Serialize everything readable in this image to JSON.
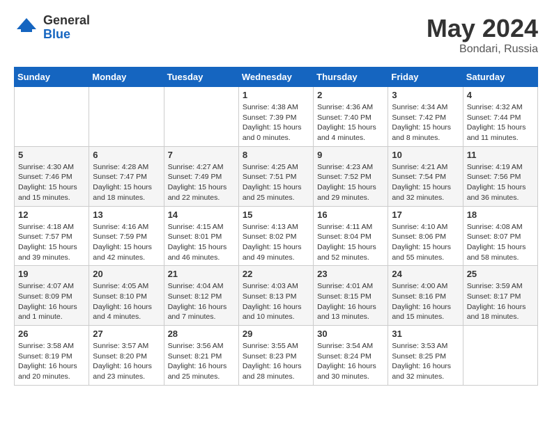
{
  "header": {
    "logo_general": "General",
    "logo_blue": "Blue",
    "month_title": "May 2024",
    "location": "Bondari, Russia"
  },
  "weekdays": [
    "Sunday",
    "Monday",
    "Tuesday",
    "Wednesday",
    "Thursday",
    "Friday",
    "Saturday"
  ],
  "weeks": [
    [
      {
        "day": "",
        "content": ""
      },
      {
        "day": "",
        "content": ""
      },
      {
        "day": "",
        "content": ""
      },
      {
        "day": "1",
        "content": "Sunrise: 4:38 AM\nSunset: 7:39 PM\nDaylight: 15 hours\nand 0 minutes."
      },
      {
        "day": "2",
        "content": "Sunrise: 4:36 AM\nSunset: 7:40 PM\nDaylight: 15 hours\nand 4 minutes."
      },
      {
        "day": "3",
        "content": "Sunrise: 4:34 AM\nSunset: 7:42 PM\nDaylight: 15 hours\nand 8 minutes."
      },
      {
        "day": "4",
        "content": "Sunrise: 4:32 AM\nSunset: 7:44 PM\nDaylight: 15 hours\nand 11 minutes."
      }
    ],
    [
      {
        "day": "5",
        "content": "Sunrise: 4:30 AM\nSunset: 7:46 PM\nDaylight: 15 hours\nand 15 minutes."
      },
      {
        "day": "6",
        "content": "Sunrise: 4:28 AM\nSunset: 7:47 PM\nDaylight: 15 hours\nand 18 minutes."
      },
      {
        "day": "7",
        "content": "Sunrise: 4:27 AM\nSunset: 7:49 PM\nDaylight: 15 hours\nand 22 minutes."
      },
      {
        "day": "8",
        "content": "Sunrise: 4:25 AM\nSunset: 7:51 PM\nDaylight: 15 hours\nand 25 minutes."
      },
      {
        "day": "9",
        "content": "Sunrise: 4:23 AM\nSunset: 7:52 PM\nDaylight: 15 hours\nand 29 minutes."
      },
      {
        "day": "10",
        "content": "Sunrise: 4:21 AM\nSunset: 7:54 PM\nDaylight: 15 hours\nand 32 minutes."
      },
      {
        "day": "11",
        "content": "Sunrise: 4:19 AM\nSunset: 7:56 PM\nDaylight: 15 hours\nand 36 minutes."
      }
    ],
    [
      {
        "day": "12",
        "content": "Sunrise: 4:18 AM\nSunset: 7:57 PM\nDaylight: 15 hours\nand 39 minutes."
      },
      {
        "day": "13",
        "content": "Sunrise: 4:16 AM\nSunset: 7:59 PM\nDaylight: 15 hours\nand 42 minutes."
      },
      {
        "day": "14",
        "content": "Sunrise: 4:15 AM\nSunset: 8:01 PM\nDaylight: 15 hours\nand 46 minutes."
      },
      {
        "day": "15",
        "content": "Sunrise: 4:13 AM\nSunset: 8:02 PM\nDaylight: 15 hours\nand 49 minutes."
      },
      {
        "day": "16",
        "content": "Sunrise: 4:11 AM\nSunset: 8:04 PM\nDaylight: 15 hours\nand 52 minutes."
      },
      {
        "day": "17",
        "content": "Sunrise: 4:10 AM\nSunset: 8:06 PM\nDaylight: 15 hours\nand 55 minutes."
      },
      {
        "day": "18",
        "content": "Sunrise: 4:08 AM\nSunset: 8:07 PM\nDaylight: 15 hours\nand 58 minutes."
      }
    ],
    [
      {
        "day": "19",
        "content": "Sunrise: 4:07 AM\nSunset: 8:09 PM\nDaylight: 16 hours\nand 1 minute."
      },
      {
        "day": "20",
        "content": "Sunrise: 4:05 AM\nSunset: 8:10 PM\nDaylight: 16 hours\nand 4 minutes."
      },
      {
        "day": "21",
        "content": "Sunrise: 4:04 AM\nSunset: 8:12 PM\nDaylight: 16 hours\nand 7 minutes."
      },
      {
        "day": "22",
        "content": "Sunrise: 4:03 AM\nSunset: 8:13 PM\nDaylight: 16 hours\nand 10 minutes."
      },
      {
        "day": "23",
        "content": "Sunrise: 4:01 AM\nSunset: 8:15 PM\nDaylight: 16 hours\nand 13 minutes."
      },
      {
        "day": "24",
        "content": "Sunrise: 4:00 AM\nSunset: 8:16 PM\nDaylight: 16 hours\nand 15 minutes."
      },
      {
        "day": "25",
        "content": "Sunrise: 3:59 AM\nSunset: 8:17 PM\nDaylight: 16 hours\nand 18 minutes."
      }
    ],
    [
      {
        "day": "26",
        "content": "Sunrise: 3:58 AM\nSunset: 8:19 PM\nDaylight: 16 hours\nand 20 minutes."
      },
      {
        "day": "27",
        "content": "Sunrise: 3:57 AM\nSunset: 8:20 PM\nDaylight: 16 hours\nand 23 minutes."
      },
      {
        "day": "28",
        "content": "Sunrise: 3:56 AM\nSunset: 8:21 PM\nDaylight: 16 hours\nand 25 minutes."
      },
      {
        "day": "29",
        "content": "Sunrise: 3:55 AM\nSunset: 8:23 PM\nDaylight: 16 hours\nand 28 minutes."
      },
      {
        "day": "30",
        "content": "Sunrise: 3:54 AM\nSunset: 8:24 PM\nDaylight: 16 hours\nand 30 minutes."
      },
      {
        "day": "31",
        "content": "Sunrise: 3:53 AM\nSunset: 8:25 PM\nDaylight: 16 hours\nand 32 minutes."
      },
      {
        "day": "",
        "content": ""
      }
    ]
  ]
}
